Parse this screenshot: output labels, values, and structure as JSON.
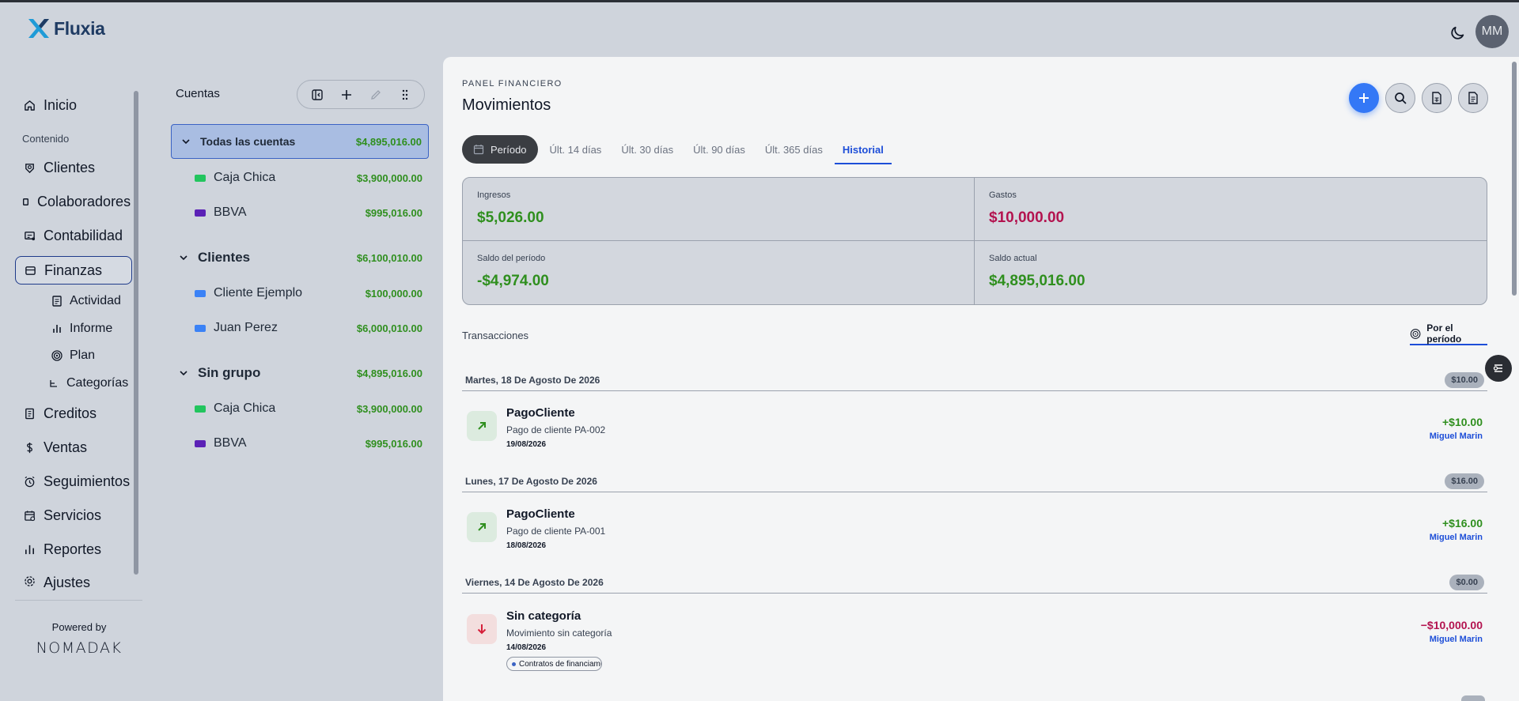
{
  "app": {
    "name": "Fluxia",
    "avatar_initials": "MM"
  },
  "nav": {
    "items_top": [
      {
        "label": "Inicio",
        "icon": "home-icon"
      }
    ],
    "section_label": "Contenido",
    "items_content": [
      {
        "label": "Clientes",
        "icon": "users-icon"
      },
      {
        "label": "Colaboradores",
        "icon": "user-badge-icon"
      },
      {
        "label": "Contabilidad",
        "icon": "ledger-icon"
      },
      {
        "label": "Finanzas",
        "icon": "wallet-icon"
      }
    ],
    "sub_items": [
      {
        "label": "Actividad",
        "icon": "document-icon"
      },
      {
        "label": "Informe",
        "icon": "bar-chart-icon"
      },
      {
        "label": "Plan",
        "icon": "target-icon"
      },
      {
        "label": "Categorías",
        "icon": "tag-icon"
      }
    ],
    "items_bottom": [
      {
        "label": "Creditos",
        "icon": "receipt-icon"
      },
      {
        "label": "Ventas",
        "icon": "dollar-icon"
      },
      {
        "label": "Seguimientos",
        "icon": "alarm-icon"
      },
      {
        "label": "Servicios",
        "icon": "calendar-icon"
      },
      {
        "label": "Reportes",
        "icon": "bar-chart-icon"
      },
      {
        "label": "Ajustes",
        "icon": "gear-icon"
      }
    ],
    "powered_by": "Powered by",
    "brand": "NOMADAK"
  },
  "accounts": {
    "title": "Cuentas",
    "all": {
      "label": "Todas las cuentas",
      "amount": "$4,895,016.00"
    },
    "all_children": [
      {
        "label": "Caja Chica",
        "amount": "$3,900,000.00",
        "color": "#22c55e"
      },
      {
        "label": "BBVA",
        "amount": "$995,016.00",
        "color": "#5b21b6"
      }
    ],
    "groups": [
      {
        "label": "Clientes",
        "amount": "$6,100,010.00",
        "children": [
          {
            "label": "Cliente Ejemplo",
            "amount": "$100,000.00",
            "color": "#3b82f6"
          },
          {
            "label": "Juan Perez",
            "amount": "$6,000,010.00",
            "color": "#3b82f6"
          }
        ]
      },
      {
        "label": "Sin grupo",
        "amount": "$4,895,016.00",
        "children": [
          {
            "label": "Caja Chica",
            "amount": "$3,900,000.00",
            "color": "#22c55e"
          },
          {
            "label": "BBVA",
            "amount": "$995,016.00",
            "color": "#5b21b6"
          }
        ]
      }
    ]
  },
  "main": {
    "kicker": "PANEL FINANCIERO",
    "title": "Movimientos",
    "tabs": {
      "periodo": "Período",
      "items": [
        "Últ. 14 días",
        "Últ. 30 días",
        "Últ. 90 días",
        "Últ. 365 días",
        "Historial"
      ],
      "active": "Historial"
    },
    "stats": [
      {
        "label": "Ingresos",
        "value": "$5,026.00",
        "tone": "pos"
      },
      {
        "label": "Gastos",
        "value": "$10,000.00",
        "tone": "neg"
      },
      {
        "label": "Saldo del período",
        "value": "-$4,974.00",
        "tone": "pos"
      },
      {
        "label": "Saldo actual",
        "value": "$4,895,016.00",
        "tone": "pos"
      }
    ],
    "transactions_title": "Transacciones",
    "filter_label": "Por el período",
    "days": [
      {
        "date": "Martes, 18 De Agosto De 2026",
        "total": "$10.00",
        "tx": {
          "name": "PagoCliente",
          "desc": "Pago de cliente PA-002",
          "date": "19/08/2026",
          "amount": "+$10.00",
          "user": "Miguel Marin",
          "dir": "in"
        }
      },
      {
        "date": "Lunes, 17 De Agosto De 2026",
        "total": "$16.00",
        "tx": {
          "name": "PagoCliente",
          "desc": "Pago de cliente PA-001",
          "date": "18/08/2026",
          "amount": "+$16.00",
          "user": "Miguel Marin",
          "dir": "in"
        }
      },
      {
        "date": "Viernes, 14 De Agosto De 2026",
        "total": "$0.00",
        "tx": {
          "name": "Sin categoría",
          "desc": "Movimiento sin categoría",
          "date": "14/08/2026",
          "amount": "−$10,000.00",
          "user": "Miguel Marin",
          "dir": "out",
          "chip": "Contratos de financiamiento"
        }
      }
    ]
  }
}
